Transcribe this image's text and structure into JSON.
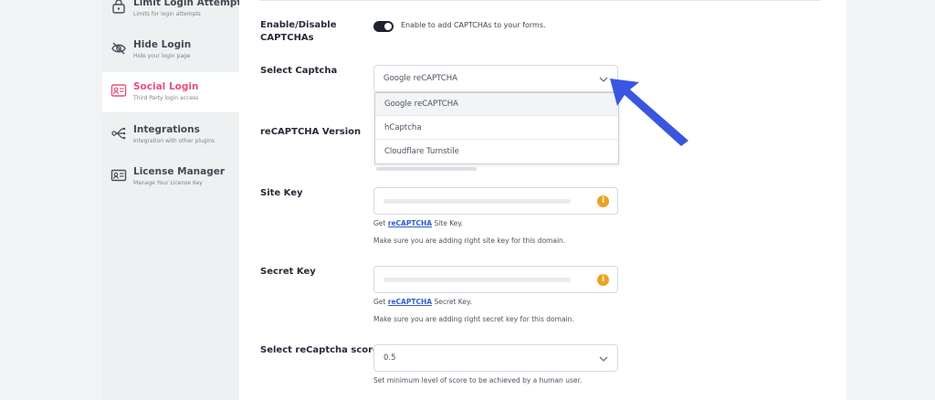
{
  "sidebar": {
    "items": [
      {
        "title": "Limit Login Attempts",
        "subtitle": "Limits for login attempts",
        "icon": "lock-icon"
      },
      {
        "title": "Hide Login",
        "subtitle": "Hide your login page",
        "icon": "eye-slash-icon"
      },
      {
        "title": "Social Login",
        "subtitle": "Third Party login access",
        "icon": "user-card-icon"
      },
      {
        "title": "Integrations",
        "subtitle": "Integration with other plugins",
        "icon": "integration-icon"
      },
      {
        "title": "License Manager",
        "subtitle": "Manage Your License Key",
        "icon": "id-card-icon"
      }
    ],
    "active_index": 2
  },
  "form": {
    "enable": {
      "label_line1": "Enable/Disable",
      "label_line2": "CAPTCHAs",
      "toggle_text": "Enable to add CAPTCHAs to your forms.",
      "checked": true
    },
    "select_captcha": {
      "label": "Select Captcha",
      "value": "Google reCAPTCHA",
      "options": [
        "Google reCAPTCHA",
        "hCaptcha",
        "Cloudflare Turnstile"
      ]
    },
    "recaptcha_version": {
      "label": "reCAPTCHA Version"
    },
    "site_key": {
      "label": "Site Key",
      "help_prefix": "Get ",
      "help_link": "reCAPTCHA",
      "help_suffix": " Site Key.",
      "note": "Make sure you are adding right site key for this domain."
    },
    "secret_key": {
      "label": "Secret Key",
      "help_prefix": "Get ",
      "help_link": "reCAPTCHA",
      "help_suffix": " Secret Key.",
      "note": "Make sure you are adding right secret key for this domain."
    },
    "score": {
      "label": "Select reCaptcha score",
      "value": "0.5",
      "help": "Set minimum level of score to be achieved by a human user."
    }
  },
  "colors": {
    "accent": "#e8507a",
    "link": "#2f5fd0",
    "pointer_arrow": "#3a55e0",
    "info": "#f0a020"
  }
}
